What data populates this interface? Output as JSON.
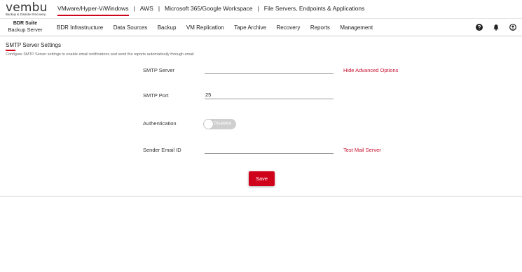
{
  "logo": {
    "word": "vembu",
    "tagline": "Backup & Disaster Recovery"
  },
  "products": [
    {
      "label": "VMware/Hyper-V/Windows",
      "active": true
    },
    {
      "label": "AWS",
      "active": false
    },
    {
      "label": "Microsoft 365/Google Workspace",
      "active": false
    },
    {
      "label": "File Servers, Endpoints & Applications",
      "active": false
    }
  ],
  "separator": "|",
  "brand": {
    "title": "BDR Suite",
    "subtitle": "Backup Server"
  },
  "nav": [
    "BDR Infrastructure",
    "Data Sources",
    "Backup",
    "VM Replication",
    "Tape Archive",
    "Recovery",
    "Reports",
    "Management"
  ],
  "nav_icons": [
    "help-icon",
    "notification-bell-icon",
    "user-account-icon"
  ],
  "page": {
    "title": "SMTP Server Settings",
    "description": "Configure SMTP Server settings to enable email notifications and send the reports automatically through email"
  },
  "form": {
    "smtp_server": {
      "label": "SMTP Server",
      "value": ""
    },
    "smtp_port": {
      "label": "SMTP Port",
      "value": "25"
    },
    "authentication": {
      "label": "Authentication",
      "toggle_text": "Disabled",
      "enabled": false
    },
    "sender_email": {
      "label": "Sender Email ID",
      "value": ""
    },
    "hide_advanced_link": "Hide Advanced Options",
    "test_mail_link": "Test Mail Server",
    "save_label": "Save"
  },
  "colors": {
    "accent": "#d0021b",
    "link": "#c8102e",
    "toggle_off": "#cfcfcf"
  }
}
